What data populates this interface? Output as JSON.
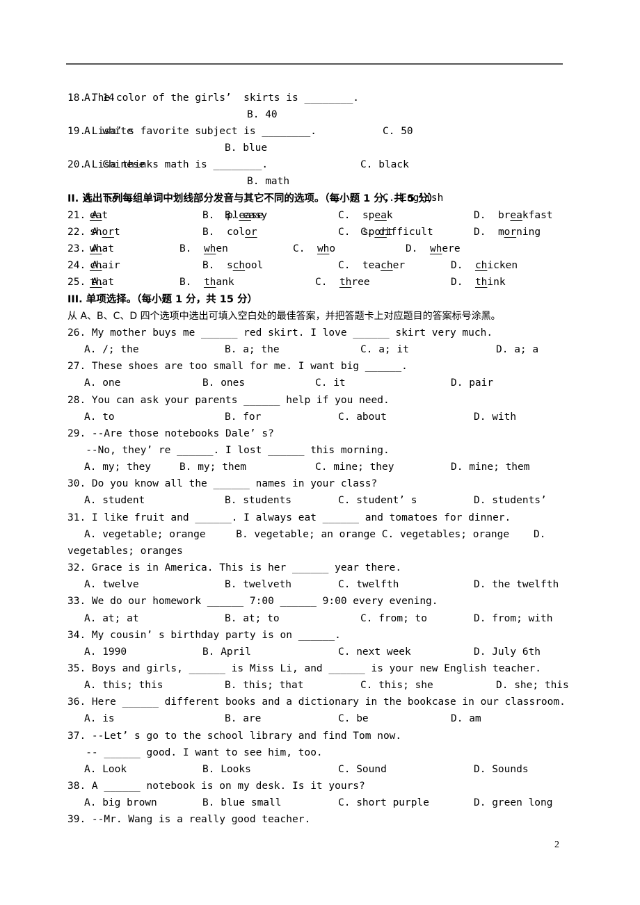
{
  "top_rule": true,
  "page_number": "2",
  "q17_options": [
    "A. 14",
    "B. 40",
    "C. 50"
  ],
  "questions_listening": [
    {
      "stem": "18. The color of the girls’  skirts is ________.",
      "options": [
        "A. white",
        "B. blue",
        "C. black"
      ]
    },
    {
      "stem": "19. Lisa’ s favorite subject is ________.",
      "options": [
        "A. Chinese",
        "B. math",
        "C. English"
      ]
    },
    {
      "stem": "20. Lisa thinks math is ________.",
      "options": [
        "A. fun",
        "B. easy",
        "C. difficult"
      ]
    }
  ],
  "section2": {
    "title": "II. 选出下列每组单词中划线部分发音与其它不同的选项。（每小题 1 分，共 5 分）",
    "items": [
      {
        "num": "21. A.",
        "options": [
          {
            "pre": "",
            "u": "ea",
            "post": "t"
          },
          {
            "label": "B.",
            "pre": "pl",
            "u": "ea",
            "post": "se"
          },
          {
            "label": "C.",
            "pre": "sp",
            "u": "ea",
            "post": "k"
          },
          {
            "label": "D.",
            "pre": "br",
            "u": "ea",
            "post": "kfast"
          }
        ]
      },
      {
        "num": "22. A.",
        "options": [
          {
            "pre": "sh",
            "u": "or",
            "post": "t"
          },
          {
            "label": "B.",
            "pre": "col",
            "u": "or",
            "post": ""
          },
          {
            "label": "C.",
            "pre": "sp",
            "u": "or",
            "post": "t"
          },
          {
            "label": "D.",
            "pre": "m",
            "u": "or",
            "post": "ning"
          }
        ]
      },
      {
        "num": "23. A.",
        "options": [
          {
            "pre": "",
            "u": "wh",
            "post": "at"
          },
          {
            "label": "B.",
            "pre": "",
            "u": "wh",
            "post": "en"
          },
          {
            "label": "C.",
            "pre": "",
            "u": "wh",
            "post": "o"
          },
          {
            "label": "D.",
            "pre": "",
            "u": "wh",
            "post": "ere"
          }
        ]
      },
      {
        "num": "24. A.",
        "options": [
          {
            "pre": "",
            "u": "ch",
            "post": "air"
          },
          {
            "label": "B.",
            "pre": "s",
            "u": "ch",
            "post": "ool"
          },
          {
            "label": "C.",
            "pre": "tea",
            "u": "ch",
            "post": "er"
          },
          {
            "label": "D.",
            "pre": "",
            "u": "ch",
            "post": "icken"
          }
        ]
      },
      {
        "num": "25. A.",
        "options": [
          {
            "pre": "",
            "u": "th",
            "post": "at"
          },
          {
            "label": "B.",
            "pre": "",
            "u": "th",
            "post": "ank"
          },
          {
            "label": "C.",
            "pre": "",
            "u": "th",
            "post": "ree"
          },
          {
            "label": "D.",
            "pre": "",
            "u": "th",
            "post": "ink"
          }
        ]
      }
    ]
  },
  "section3": {
    "title": "III. 单项选择。（每小题 1 分，共 15 分）",
    "instruction": "从 A、B、C、D 四个选项中选出可填入空白处的最佳答案，并把答题卡上对应题目的答案标号涂黑。",
    "questions": [
      {
        "stem": [
          "26. My mother buys me ______ red skirt. I love ______ skirt very much."
        ],
        "options": [
          "A. /; the",
          "B. a; the",
          "C. a; it",
          "D. a; a"
        ]
      },
      {
        "stem": [
          "27. These shoes are too small for me. I want big ______."
        ],
        "options": [
          "A. one",
          "B. ones",
          "C. it",
          "D. pair"
        ]
      },
      {
        "stem": [
          "28. You can ask your parents ______ help if you need."
        ],
        "options": [
          "A. to",
          "B. for",
          "C. about",
          "D. with"
        ]
      },
      {
        "stem": [
          "29. --Are those notebooks Dale’ s?",
          "   --No, they’ re ______. I lost ______ this morning."
        ],
        "options": [
          "A. my; they",
          "B. my; them",
          "C. mine; they",
          "D. mine; them"
        ]
      },
      {
        "stem": [
          "30. Do you know all the ______ names in your class?"
        ],
        "options": [
          "A. student",
          "B. students",
          "C. student’ s",
          "D. students’"
        ]
      },
      {
        "stem": [
          "31. I like fruit and ______. I always eat ______ and tomatoes for dinner."
        ],
        "options_line": "A. vegetable; orange     B. vegetable; an orange C. vegetables; orange    D.",
        "options_wrap": "vegetables; oranges"
      },
      {
        "stem": [
          "32. Grace is in America. This is her ______ year there."
        ],
        "options": [
          "A. twelve",
          "B. twelveth",
          "C. twelfth",
          "D. the twelfth"
        ]
      },
      {
        "stem": [
          "33. We do our homework ______ 7:00 ______ 9:00 every evening."
        ],
        "options": [
          "A. at; at",
          "B. at; to",
          "C. from; to",
          "D. from; with"
        ]
      },
      {
        "stem": [
          "34. My cousin’ s birthday party is on ______."
        ],
        "options": [
          "A. 1990",
          "B. April",
          "C. next week",
          "D. July 6th"
        ]
      },
      {
        "stem": [
          "35. Boys and girls, ______ is Miss Li, and ______ is your new English teacher."
        ],
        "options": [
          "A. this; this",
          "B. this; that",
          "C. this; she",
          "D. she; this"
        ]
      },
      {
        "stem": [
          "36. Here ______ different books and a dictionary in the bookcase in our classroom."
        ],
        "options": [
          "A. is",
          "B. are",
          "C. be",
          "D. am"
        ]
      },
      {
        "stem": [
          "37. --Let’ s go to the school library and find Tom now.",
          "   -- ______ good. I want to see him, too."
        ],
        "options": [
          "A. Look",
          "B. Looks",
          "C. Sound",
          "D. Sounds"
        ]
      },
      {
        "stem": [
          "38. A ______ notebook is on my desk. Is it yours?"
        ],
        "options": [
          "A. big brown",
          "B. blue small",
          "C. short purple",
          "D. green long"
        ]
      },
      {
        "stem": [
          "39. --Mr. Wang is a really good teacher."
        ]
      }
    ]
  }
}
